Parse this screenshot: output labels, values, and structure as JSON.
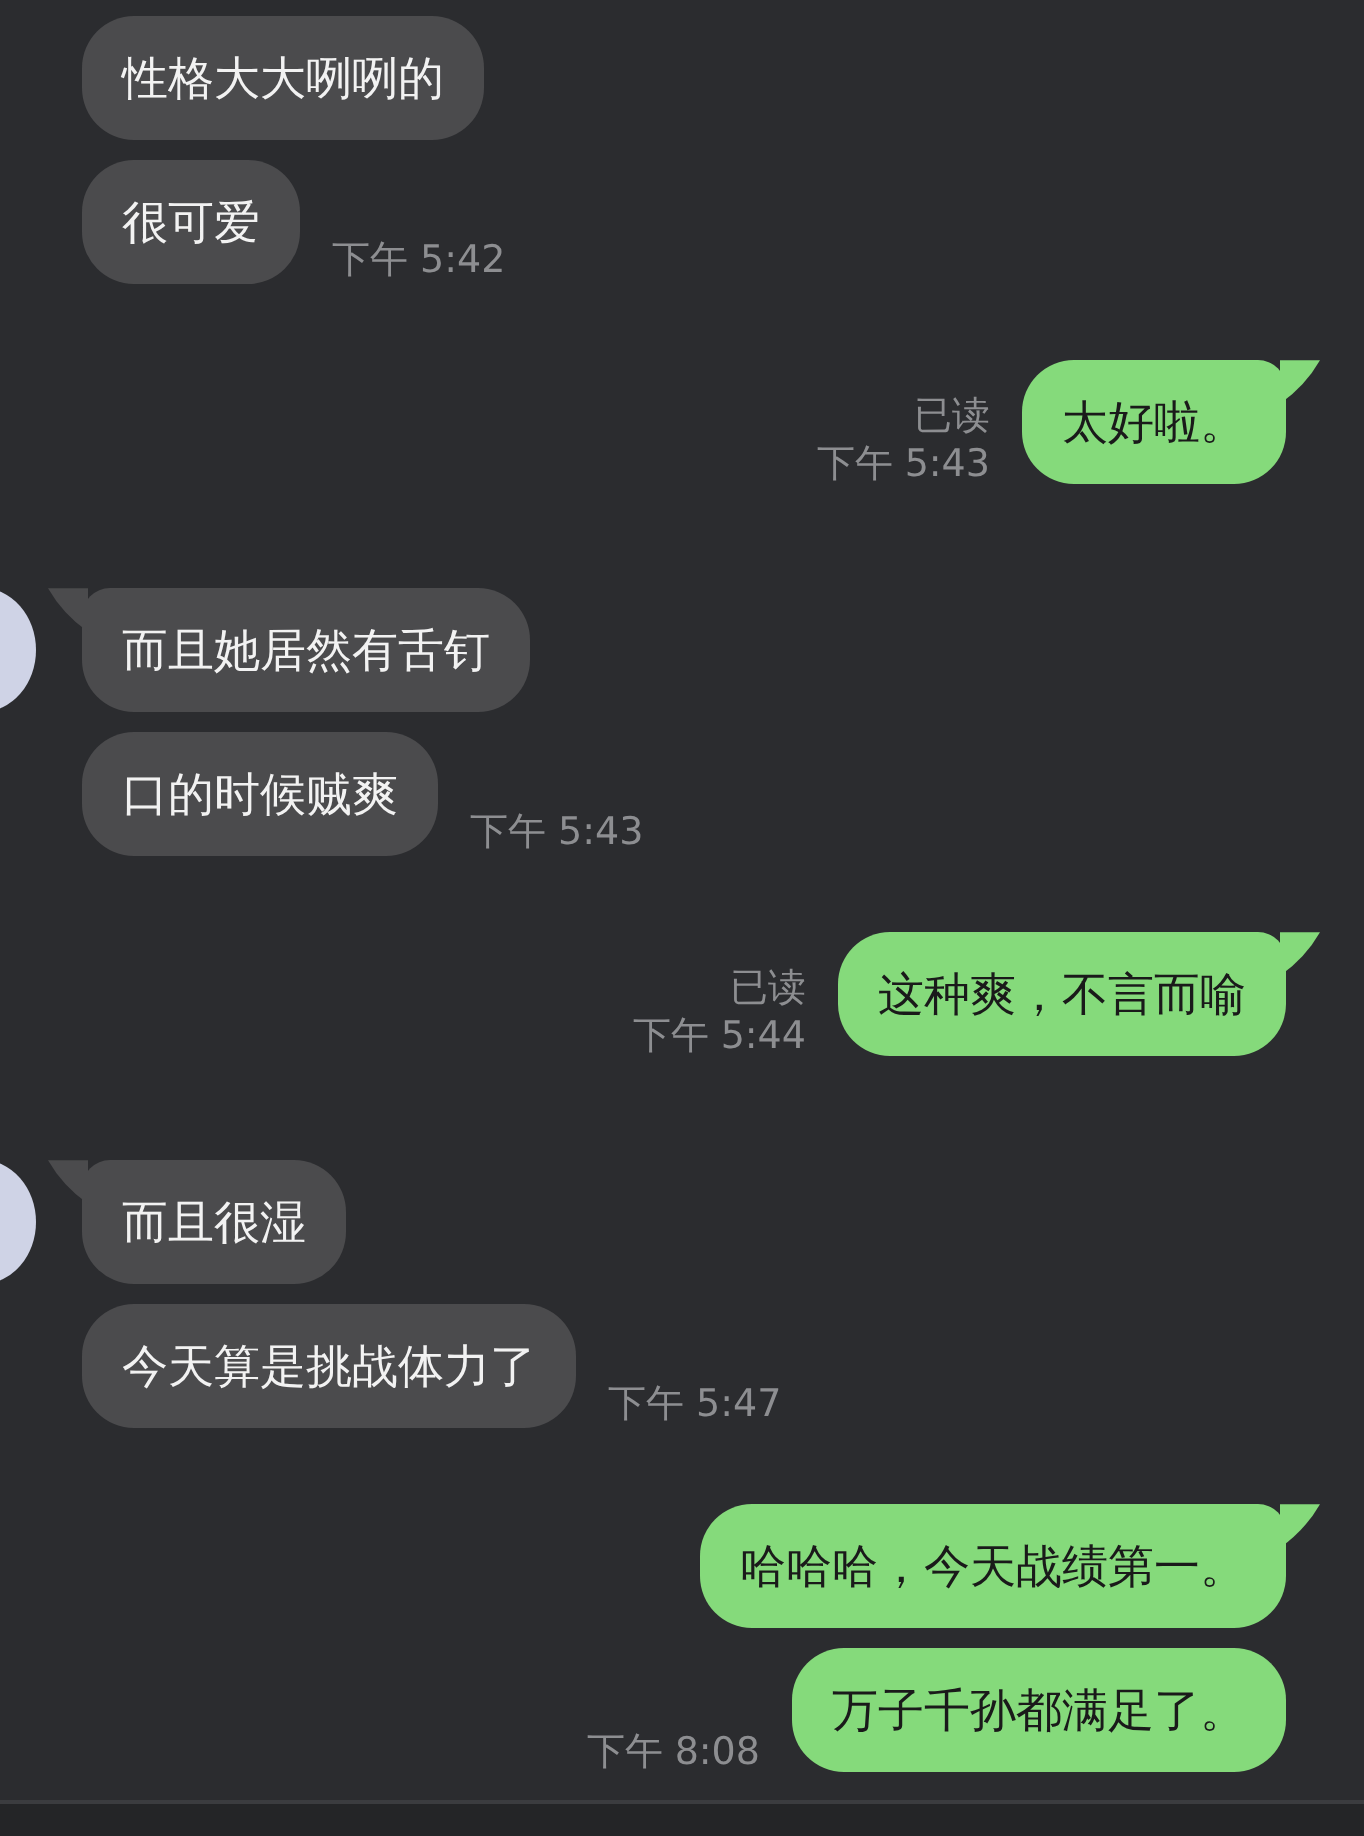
{
  "groups": [
    {
      "kind": "incoming",
      "avatar": false,
      "messages": [
        {
          "text": "性格大大咧咧的"
        },
        {
          "text": "很可爱",
          "time": "下午 5:42"
        }
      ]
    },
    {
      "kind": "outgoing",
      "avatar": false,
      "messages": [
        {
          "text": "太好啦。",
          "tail": true,
          "read": "已读",
          "time": "下午 5:43"
        }
      ]
    },
    {
      "kind": "incoming",
      "avatar": true,
      "messages": [
        {
          "text": "而且她居然有舌钉",
          "tail": true
        },
        {
          "text": "口的时候贼爽",
          "time": "下午 5:43"
        }
      ]
    },
    {
      "kind": "outgoing",
      "avatar": false,
      "messages": [
        {
          "text": "这种爽，不言而喻",
          "tail": true,
          "read": "已读",
          "time": "下午 5:44"
        }
      ]
    },
    {
      "kind": "incoming",
      "avatar": true,
      "messages": [
        {
          "text": "而且很湿",
          "tail": true
        },
        {
          "text": "今天算是挑战体力了",
          "time": "下午 5:47"
        }
      ]
    },
    {
      "kind": "outgoing",
      "avatar": false,
      "messages": [
        {
          "text": "哈哈哈，今天战绩第一。",
          "tail": true
        },
        {
          "text": "万子千孙都满足了。",
          "time": "下午 8:08"
        }
      ]
    }
  ]
}
